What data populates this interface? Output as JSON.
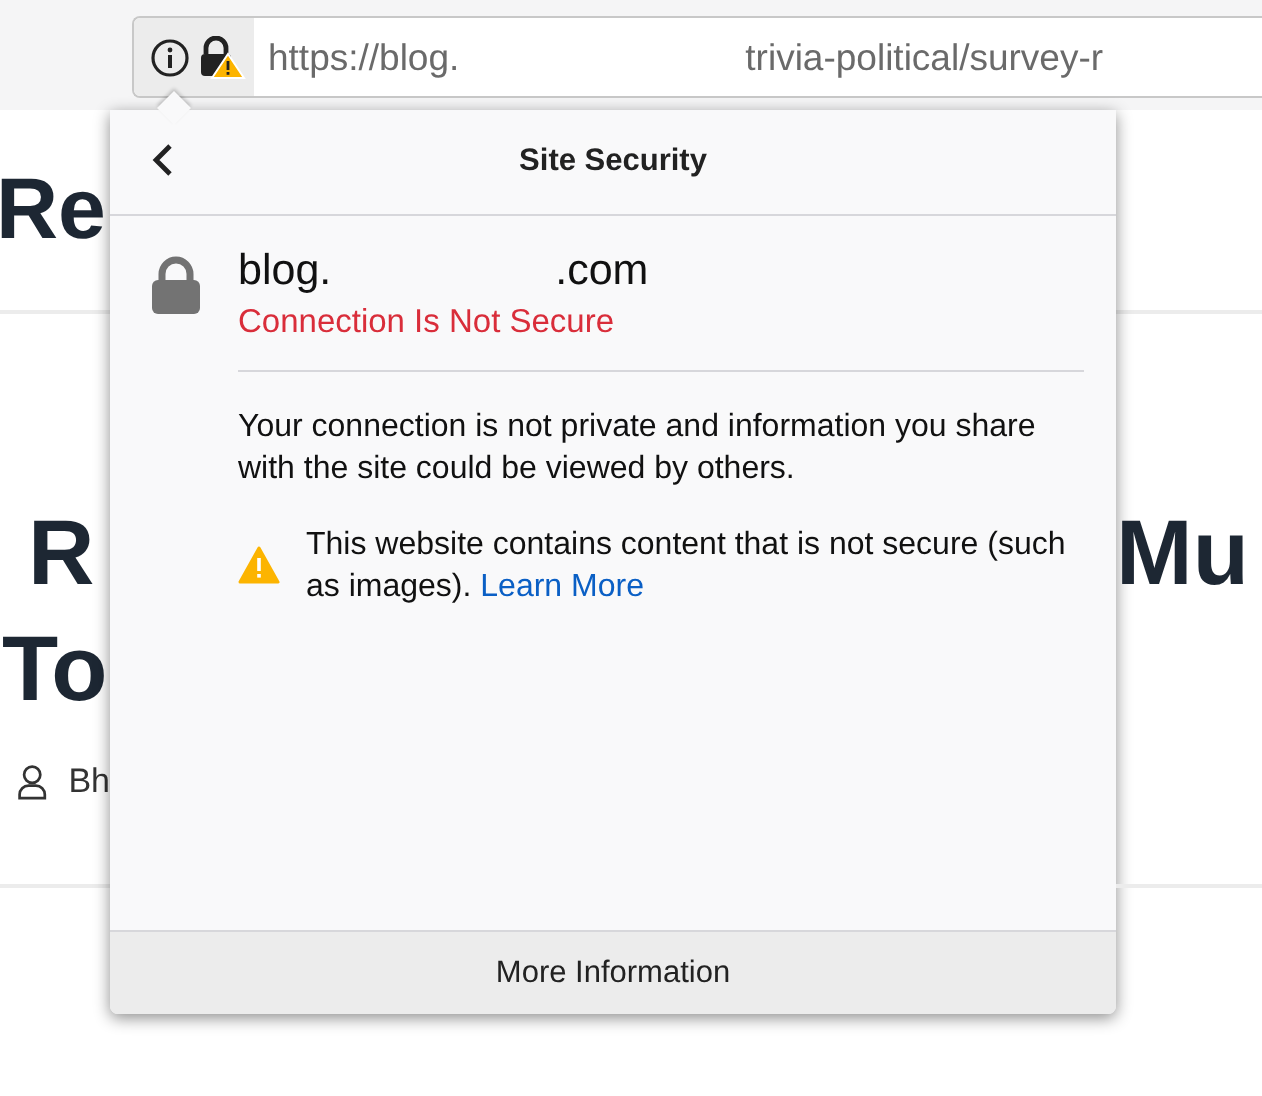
{
  "toolbar": {
    "url": {
      "start": "https://blog.",
      "end": "trivia-political/survey-r"
    }
  },
  "page_behind": {
    "heading_1": "Re",
    "heading_2_lines": [
      "R",
      "To"
    ],
    "heading_2_right": "Mu",
    "author": "Bh"
  },
  "panel": {
    "title": "Site Security",
    "site": {
      "start": "blog.",
      "end": ".com"
    },
    "status": "Connection Is Not Secure",
    "description": "Your connection is not private and information you share with the site could be viewed by others.",
    "warning": {
      "text": "This website contains content that is not secure (such as images). ",
      "link": "Learn More"
    },
    "footer_button": "More Information"
  }
}
